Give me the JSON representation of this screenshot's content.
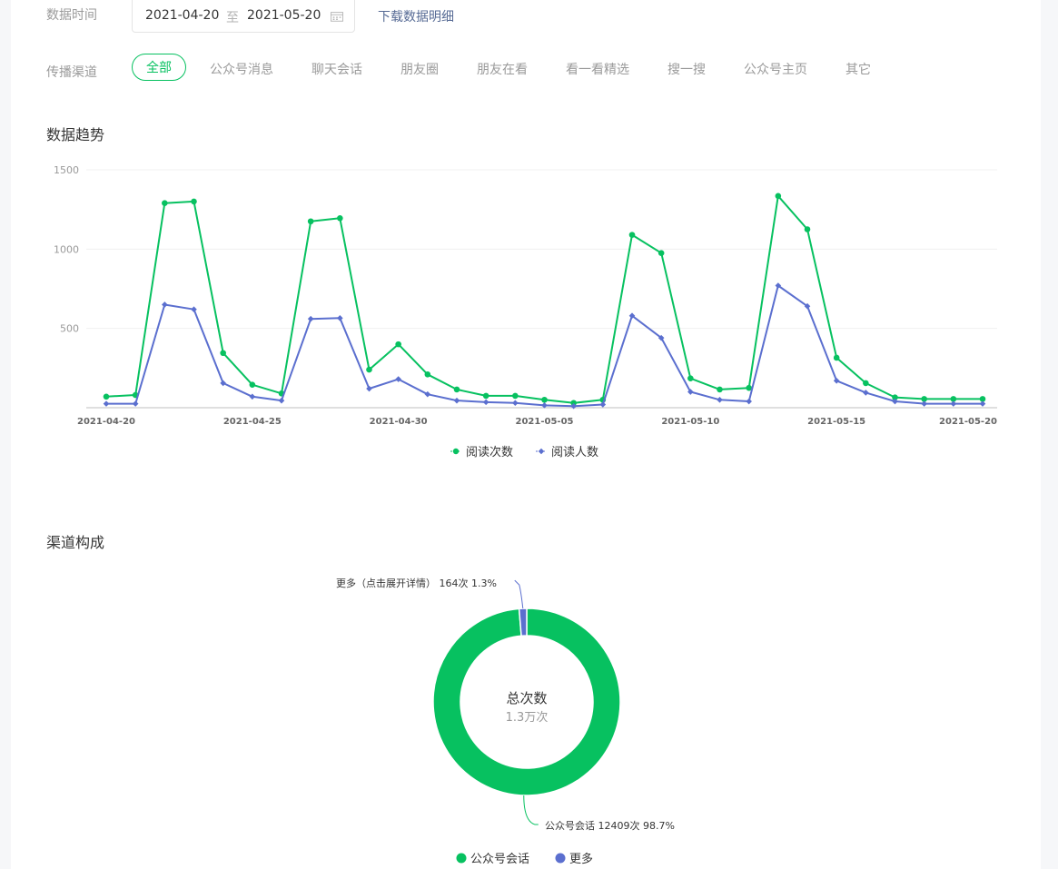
{
  "filters": {
    "date_label": "数据时间",
    "date_start": "2021-04-20",
    "date_sep": "至",
    "date_end": "2021-05-20",
    "download_label": "下载数据明细",
    "channel_label": "传播渠道",
    "channels": [
      "全部",
      "公众号消息",
      "聊天会话",
      "朋友圈",
      "朋友在看",
      "看一看精选",
      "搜一搜",
      "公众号主页",
      "其它"
    ],
    "active_channel": "全部"
  },
  "trend": {
    "title": "数据趋势"
  },
  "composition": {
    "title": "渠道构成",
    "center_title": "总次数",
    "center_value": "1.3万次",
    "label_more": "更多（点击展开详情） 164次 1.3%",
    "label_main": "公众号会话 12409次 98.7%",
    "legend": [
      "公众号会话",
      "更多"
    ]
  },
  "colors": {
    "green": "#07c160",
    "blue": "#5b6fcf",
    "grid": "#f0f0f0",
    "axis": "#999999"
  },
  "chart_data": [
    {
      "type": "line",
      "x": [
        "2021-04-20",
        "2021-04-21",
        "2021-04-22",
        "2021-04-23",
        "2021-04-24",
        "2021-04-25",
        "2021-04-26",
        "2021-04-27",
        "2021-04-28",
        "2021-04-29",
        "2021-04-30",
        "2021-05-01",
        "2021-05-02",
        "2021-05-03",
        "2021-05-04",
        "2021-05-05",
        "2021-05-06",
        "2021-05-07",
        "2021-05-08",
        "2021-05-09",
        "2021-05-10",
        "2021-05-11",
        "2021-05-12",
        "2021-05-13",
        "2021-05-14",
        "2021-05-15",
        "2021-05-16",
        "2021-05-17",
        "2021-05-18",
        "2021-05-19",
        "2021-05-20"
      ],
      "x_tick_labels": [
        "2021-04-20",
        "2021-04-25",
        "2021-04-30",
        "2021-05-05",
        "2021-05-10",
        "2021-05-15",
        "2021-05-20"
      ],
      "ylim": [
        0,
        1500
      ],
      "y_ticks": [
        500,
        1000,
        1500
      ],
      "grid": true,
      "legend_position": "bottom-center",
      "series": [
        {
          "name": "阅读次数",
          "marker": "circle",
          "values": [
            70,
            80,
            1290,
            1300,
            345,
            145,
            90,
            1175,
            1195,
            240,
            400,
            210,
            115,
            75,
            75,
            50,
            30,
            50,
            1090,
            975,
            185,
            115,
            125,
            1335,
            1125,
            315,
            155,
            65,
            55,
            55,
            55
          ]
        },
        {
          "name": "阅读人数",
          "marker": "diamond",
          "values": [
            25,
            25,
            650,
            620,
            155,
            70,
            45,
            560,
            565,
            120,
            180,
            85,
            45,
            35,
            30,
            15,
            10,
            20,
            580,
            440,
            100,
            50,
            40,
            770,
            640,
            170,
            95,
            40,
            25,
            25,
            25
          ]
        }
      ]
    },
    {
      "type": "pie",
      "donut": true,
      "categories": [
        "公众号会话",
        "更多"
      ],
      "values": [
        12409,
        164
      ],
      "percents": [
        98.7,
        1.3
      ],
      "legend_position": "bottom-center"
    }
  ]
}
